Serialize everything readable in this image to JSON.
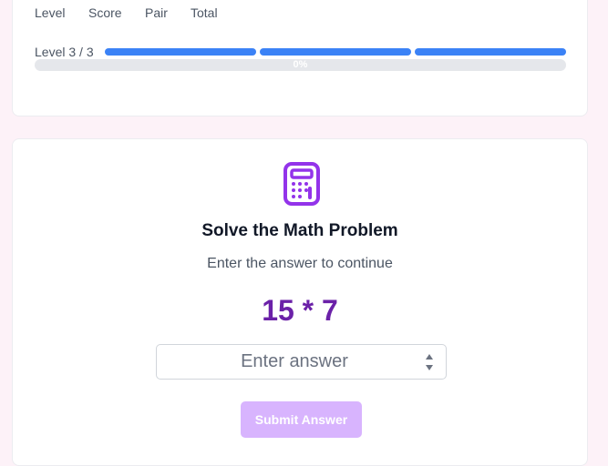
{
  "stats": {
    "level_label": "Level",
    "score_label": "Score",
    "pair_label": "Pair",
    "total_label": "Total"
  },
  "level_progress": {
    "label": "Level 3 / 3",
    "current": 3,
    "total": 3,
    "color": "#3b82f6"
  },
  "progress": {
    "text": "0%",
    "value": 0
  },
  "challenge": {
    "icon": "calculator-icon",
    "title": "Solve the Math Problem",
    "subtitle": "Enter the answer to continue",
    "problem": "15 * 7",
    "answer_placeholder": "Enter answer",
    "answer_value": "",
    "submit_label": "Submit Answer",
    "accent_color": "#9333ea",
    "problem_color": "#6b21a8",
    "submit_color": "#d8b4fe"
  }
}
